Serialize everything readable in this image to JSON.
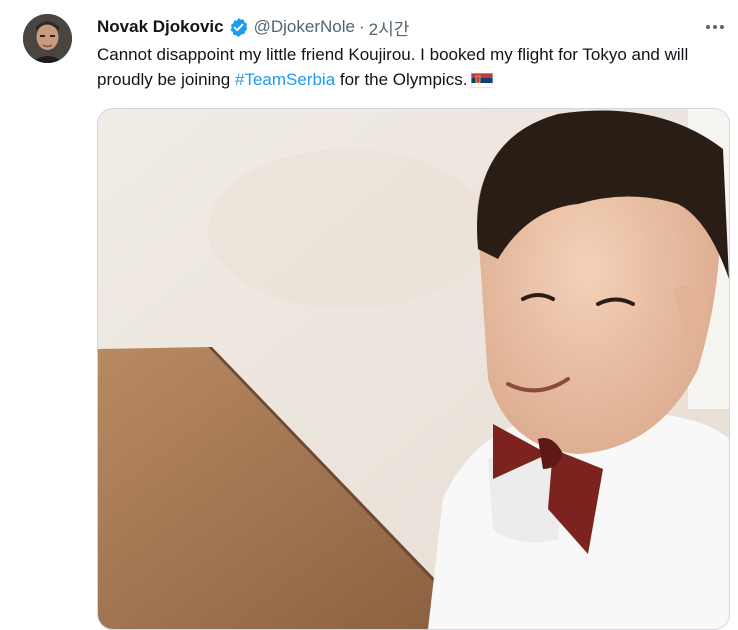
{
  "tweet": {
    "author_name": "Novak Djokovic",
    "handle": "@DjokerNole",
    "separator": "·",
    "timestamp": "2시간",
    "text_before_hashtag": "Cannot disappoint my little friend Koujirou. I booked my flight for Tokyo and will proudly be joining ",
    "hashtag": "#TeamSerbia",
    "text_after_hashtag": " for the Olympics.",
    "verified": true,
    "more_icon": "more-horizontal-icon",
    "flag_icon": "serbia-flag-emoji"
  },
  "colors": {
    "accent": "#1d9bf0",
    "text_primary": "#0f1419",
    "text_secondary": "#536471",
    "border": "#cfd9de"
  }
}
